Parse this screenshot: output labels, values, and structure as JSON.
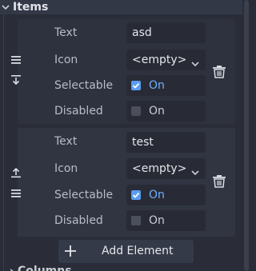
{
  "section": {
    "title": "Items"
  },
  "items": [
    {
      "text_label": "Text",
      "text_value": "asd",
      "icon_label": "Icon",
      "icon_value": "<empty>",
      "selectable_label": "Selectable",
      "selectable_state": "On",
      "selectable_checked": true,
      "disabled_label": "Disabled",
      "disabled_state": "On",
      "disabled_checked": false
    },
    {
      "text_label": "Text",
      "text_value": "test",
      "icon_label": "Icon",
      "icon_value": "<empty>",
      "selectable_label": "Selectable",
      "selectable_state": "On",
      "selectable_checked": true,
      "disabled_label": "Disabled",
      "disabled_state": "On",
      "disabled_checked": false
    }
  ],
  "add_button": {
    "label": "Add Element",
    "icon": "plus-icon"
  },
  "next_section": {
    "title": "Columns"
  },
  "icons": {
    "drag": "drag-handle-icon",
    "move_down": "move-down-icon",
    "move_up": "move-up-icon",
    "delete": "trash-icon",
    "dropdown": "chevron-down-icon"
  },
  "colors": {
    "background": "#2a2d38",
    "accent": "#5a9cf2",
    "on_active": "#6fb0ff"
  }
}
